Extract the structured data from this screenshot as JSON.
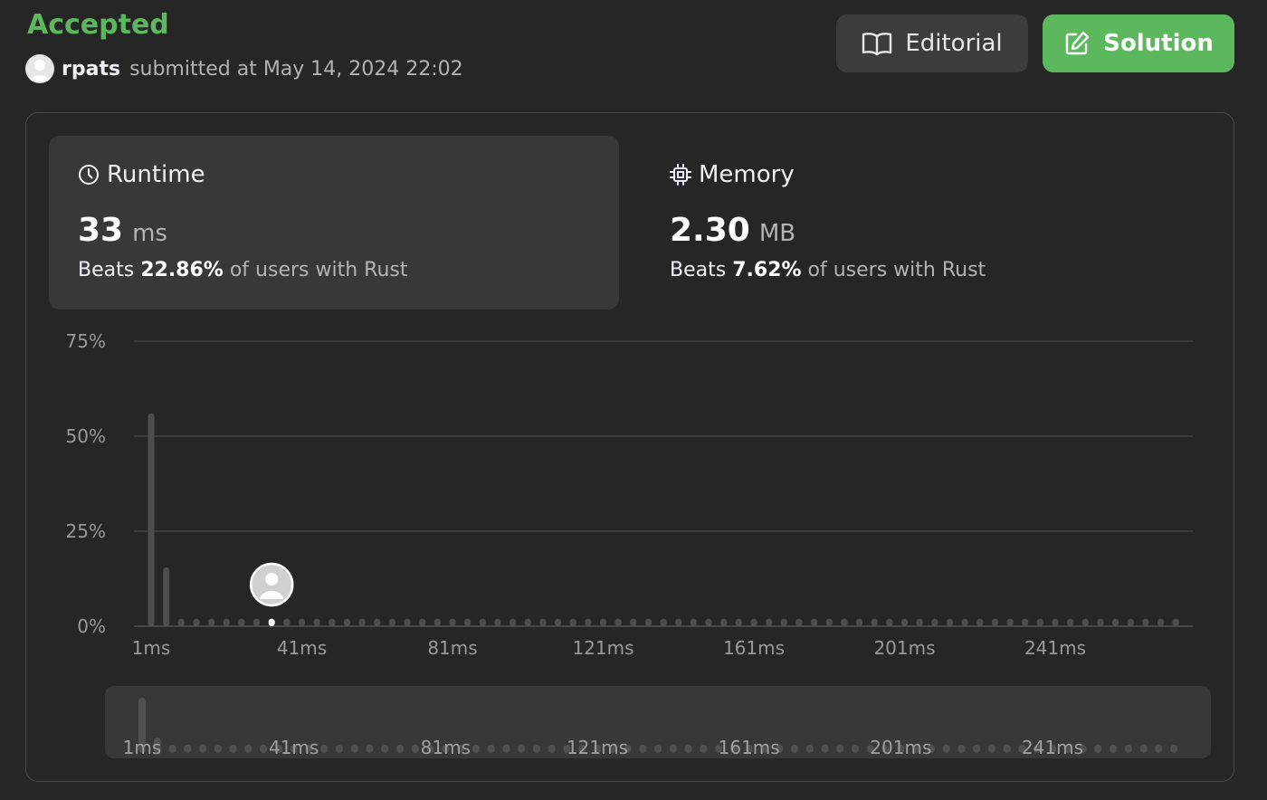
{
  "header": {
    "status": "Accepted",
    "username": "rpats",
    "submitted_text": "submitted at May 14, 2024 22:02",
    "editorial_label": "Editorial",
    "solution_label": "Solution"
  },
  "runtime": {
    "title": "Runtime",
    "value": "33",
    "unit": "ms",
    "beats_label": "Beats",
    "beats_pct": "22.86%",
    "beats_suffix": "of users with Rust"
  },
  "memory": {
    "title": "Memory",
    "value": "2.30",
    "unit": "MB",
    "beats_label": "Beats",
    "beats_pct": "7.62%",
    "beats_suffix": "of users with Rust"
  },
  "colors": {
    "accent_green": "#5cb85c",
    "background": "#262626",
    "bar": "#4d4d4d",
    "user_bar": "#ffffff"
  },
  "chart_data": {
    "type": "bar",
    "title": "",
    "xlabel": "",
    "ylabel": "",
    "ylim": [
      0,
      75
    ],
    "ytick_labels": [
      "75%",
      "50%",
      "25%",
      "0%"
    ],
    "yticks": [
      75,
      50,
      25,
      0
    ],
    "xtick_labels": [
      "1ms",
      "41ms",
      "81ms",
      "121ms",
      "161ms",
      "201ms",
      "241ms"
    ],
    "xtick_positions": [
      1,
      41,
      81,
      121,
      161,
      201,
      241
    ],
    "x_start": 1,
    "x_step": 4,
    "values": [
      56,
      15.5,
      2,
      2,
      2,
      2,
      2,
      2,
      2,
      2,
      2,
      2,
      2,
      2,
      2,
      2,
      2,
      2,
      2,
      2,
      2,
      2,
      2,
      2,
      2,
      2,
      2,
      2,
      2,
      2,
      2,
      2,
      2,
      2,
      2,
      2,
      2,
      2,
      2,
      2,
      2,
      2,
      2,
      2,
      2,
      2,
      2,
      2,
      2,
      2,
      2,
      2,
      2,
      2,
      2,
      2,
      2,
      2,
      2,
      2,
      2,
      2,
      2,
      2,
      2,
      2,
      2,
      2,
      2
    ],
    "user_bar_index": 8,
    "grid": true,
    "legend": "none"
  }
}
